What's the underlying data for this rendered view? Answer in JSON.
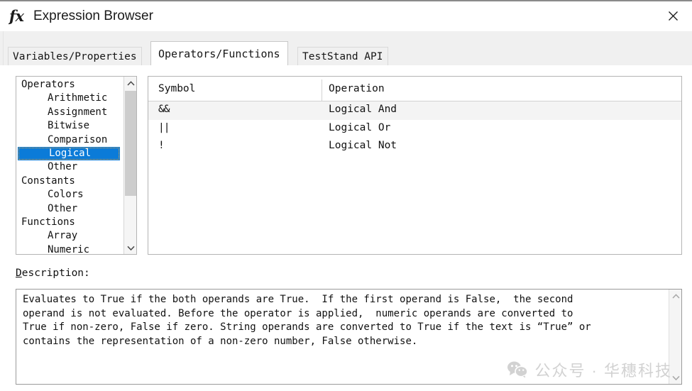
{
  "window": {
    "title": "Expression Browser",
    "icon": "fx",
    "close_label": "×"
  },
  "tabs": [
    {
      "label": "Variables/Properties",
      "active": false
    },
    {
      "label": "Operators/Functions",
      "active": true
    },
    {
      "label": "TestStand API",
      "active": false
    }
  ],
  "tree": {
    "items": [
      {
        "label": "Operators",
        "level": 0,
        "selected": false
      },
      {
        "label": "Arithmetic",
        "level": 1,
        "selected": false
      },
      {
        "label": "Assignment",
        "level": 1,
        "selected": false
      },
      {
        "label": "Bitwise",
        "level": 1,
        "selected": false
      },
      {
        "label": "Comparison",
        "level": 1,
        "selected": false
      },
      {
        "label": "Logical",
        "level": 1,
        "selected": true
      },
      {
        "label": "Other",
        "level": 1,
        "selected": false
      },
      {
        "label": "Constants",
        "level": 0,
        "selected": false
      },
      {
        "label": "Colors",
        "level": 1,
        "selected": false
      },
      {
        "label": "Other",
        "level": 1,
        "selected": false
      },
      {
        "label": "Functions",
        "level": 0,
        "selected": false
      },
      {
        "label": "Array",
        "level": 1,
        "selected": false
      },
      {
        "label": "Numeric",
        "level": 1,
        "selected": false
      }
    ]
  },
  "table": {
    "columns": [
      "Symbol",
      "Operation"
    ],
    "rows": [
      {
        "symbol": "&&",
        "operation": "Logical And",
        "highlighted": true
      },
      {
        "symbol": "||",
        "operation": "Logical Or",
        "highlighted": false
      },
      {
        "symbol": "!",
        "operation": "Logical Not",
        "highlighted": false
      }
    ]
  },
  "description": {
    "label_accel": "D",
    "label_rest": "escription:",
    "text": "Evaluates to True if the both operands are True.  If the first operand is False,  the second\noperand is not evaluated. Before the operator is applied,  numeric operands are converted to\nTrue if non-zero, False if zero. String operands are converted to True if the text is “True” or\ncontains the representation of a non-zero number, False otherwise."
  },
  "watermark": {
    "text": "公众号 · 华穗科技",
    "icon": "wechat-icon"
  },
  "colors": {
    "selection_blue": "#0b7bd8",
    "focus_dotted": "#e8a33d",
    "row_highlight": "#f4f4f4",
    "tab_inactive_bg": "#f0f0f0",
    "watermark_gray": "#d2d2d2"
  }
}
